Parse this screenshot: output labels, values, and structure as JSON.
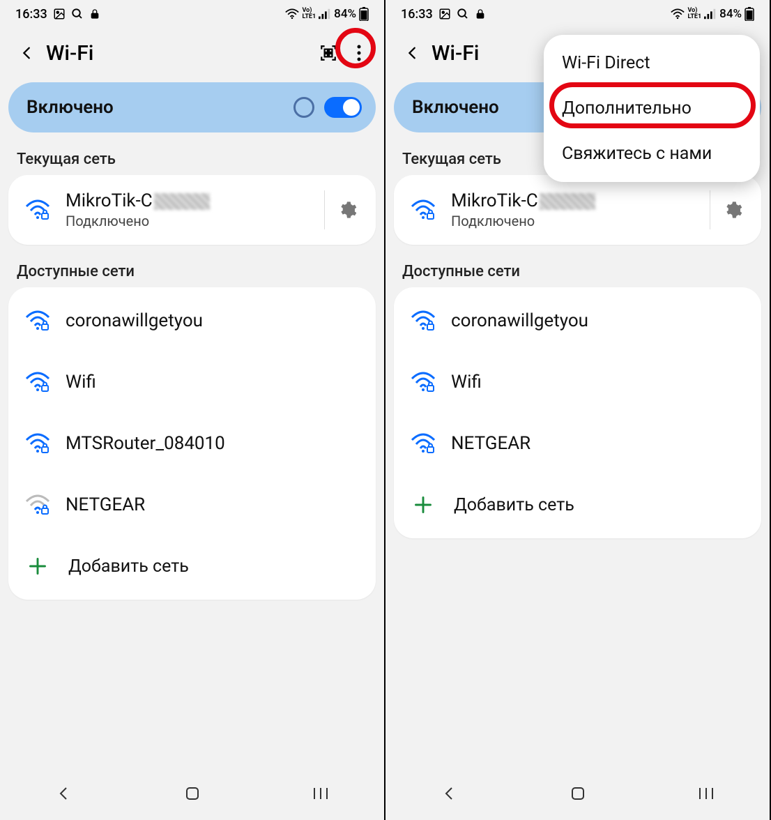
{
  "status": {
    "time": "16:33",
    "battery": "84%"
  },
  "header": {
    "title": "Wi-Fi"
  },
  "toggle": {
    "label": "Включено"
  },
  "sections": {
    "current": "Текущая сеть",
    "available": "Доступные сети"
  },
  "current_network": {
    "name": "MikroTik-C",
    "status": "Подключено"
  },
  "left_networks": [
    {
      "name": "coronawillgetyou"
    },
    {
      "name": "Wifi"
    },
    {
      "name": "MTSRouter_084010"
    },
    {
      "name": "NETGEAR"
    }
  ],
  "right_networks": [
    {
      "name": "coronawillgetyou"
    },
    {
      "name": "Wifi"
    },
    {
      "name": "NETGEAR"
    }
  ],
  "add_network": "Добавить сеть",
  "popup": {
    "direct": "Wi-Fi Direct",
    "advanced": "Дополнительно",
    "contact": "Свяжитесь с нами"
  }
}
